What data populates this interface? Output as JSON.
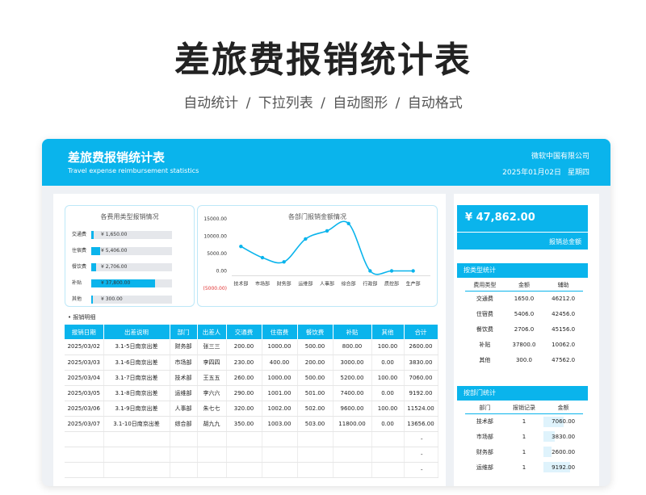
{
  "hero": {
    "title": "差旅费报销统计表",
    "subtitle": "自动统计  /  下拉列表  /  自动图形 /  自动格式"
  },
  "header": {
    "title": "差旅费报销统计表",
    "subtitle_en": "Travel expense reimbursement statistics",
    "company": "微软中国有限公司",
    "date": "2025年01月02日",
    "weekday": "星期四"
  },
  "colors": {
    "accent": "#0ab4ec"
  },
  "type_chart": {
    "title": "各费用类型报销情况",
    "items": [
      {
        "label": "交通费",
        "display": "¥ 1,650.00",
        "value": 1650
      },
      {
        "label": "住宿费",
        "display": "¥ 5,406.00",
        "value": 5406
      },
      {
        "label": "餐饮费",
        "display": "¥ 2,706.00",
        "value": 2706
      },
      {
        "label": "补贴",
        "display": "¥ 37,800.00",
        "value": 37800
      },
      {
        "label": "其他",
        "display": "¥ 300.00",
        "value": 300
      }
    ],
    "max": 47862
  },
  "chart_data": {
    "type": "line",
    "title": "各部门报销金额情况",
    "categories": [
      "技术部",
      "市场部",
      "财务部",
      "运维部",
      "人事部",
      "综合部",
      "行政部",
      "质控部",
      "生产部"
    ],
    "values": [
      7060,
      3830,
      2600,
      9192,
      11524,
      13656.8,
      0,
      0,
      0
    ],
    "yticks": [
      "15000.00",
      "10000.00",
      "5000.00",
      "0.00",
      "(5000.00)"
    ],
    "ylim": [
      -5000,
      15000
    ],
    "grid": false
  },
  "detail": {
    "label": "报销明细",
    "columns": [
      "报销日期",
      "出差说明",
      "部门",
      "出差人",
      "交通费",
      "住宿费",
      "餐饮费",
      "补贴",
      "其他",
      "合计"
    ],
    "rows": [
      [
        "2025/03/02",
        "3.1-5日南京出差",
        "财务部",
        "张三三",
        "200.00",
        "1000.00",
        "500.00",
        "800.00",
        "100.00",
        "2600.00"
      ],
      [
        "2025/03/03",
        "3.1-6日南京出差",
        "市场部",
        "李四四",
        "230.00",
        "400.00",
        "200.00",
        "3000.00",
        "0.00",
        "3830.00"
      ],
      [
        "2025/03/04",
        "3.1-7日南京出差",
        "技术部",
        "王五五",
        "260.00",
        "1000.00",
        "500.00",
        "5200.00",
        "100.00",
        "7060.00"
      ],
      [
        "2025/03/05",
        "3.1-8日南京出差",
        "运维部",
        "李六六",
        "290.00",
        "1001.00",
        "501.00",
        "7400.00",
        "0.00",
        "9192.00"
      ],
      [
        "2025/03/06",
        "3.1-9日南京出差",
        "人事部",
        "朱七七",
        "320.00",
        "1002.00",
        "502.00",
        "9600.00",
        "100.00",
        "11524.00"
      ],
      [
        "2025/03/07",
        "3.1-10日南京出差",
        "综合部",
        "胡九九",
        "350.00",
        "1003.00",
        "503.00",
        "11800.00",
        "0.00",
        "13656.00"
      ],
      [
        "",
        "",
        "",
        "",
        "",
        "",
        "",
        "",
        "",
        "-"
      ],
      [
        "",
        "",
        "",
        "",
        "",
        "",
        "",
        "",
        "",
        "-"
      ],
      [
        "",
        "",
        "",
        "",
        "",
        "",
        "",
        "",
        "",
        "-"
      ]
    ]
  },
  "total": {
    "amount": "¥ 47,862.00",
    "label": "报销总金额"
  },
  "by_type": {
    "title": "按类型统计",
    "columns": [
      "费用类型",
      "金额",
      "辅助"
    ],
    "rows": [
      [
        "交通费",
        "1650.0",
        "46212.0"
      ],
      [
        "住宿费",
        "5406.0",
        "42456.0"
      ],
      [
        "餐饮费",
        "2706.0",
        "45156.0"
      ],
      [
        "补贴",
        "37800.0",
        "10062.0"
      ],
      [
        "其他",
        "300.0",
        "47562.0"
      ]
    ]
  },
  "by_dept": {
    "title": "按部门统计",
    "columns": [
      "部门",
      "报销记录",
      "金额"
    ],
    "rows": [
      {
        "dept": "技术部",
        "count": "1",
        "amount": "7060.00",
        "value": 7060
      },
      {
        "dept": "市场部",
        "count": "1",
        "amount": "3830.00",
        "value": 3830
      },
      {
        "dept": "财务部",
        "count": "1",
        "amount": "2600.00",
        "value": 2600
      },
      {
        "dept": "运维部",
        "count": "1",
        "amount": "9192.00",
        "value": 9192
      }
    ],
    "max": 13656
  }
}
